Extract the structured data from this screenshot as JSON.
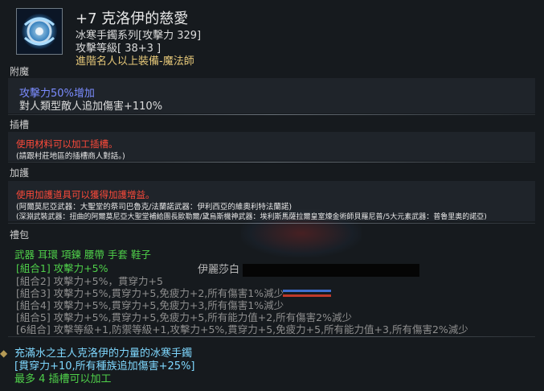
{
  "item": {
    "name": "+7 克洛伊的慈愛",
    "series": "冰寒手鐲系列[攻擊力 329]",
    "level": "攻擊等級[ 38+3 ]",
    "requirement": "進階名人以上裝備-魔法師",
    "icon": "bracelet-icon"
  },
  "sections": {
    "enchant": {
      "label": "附魔",
      "line1": "攻擊力50%增加",
      "line2": "對人類型敵人追加傷害+110%"
    },
    "socket": {
      "label": "插槽",
      "line1": "使用材料可以加工插槽。",
      "line2": "(請跟村莊地區的插槽商人對話。)"
    },
    "protect": {
      "label": "加護",
      "line1": "使用加護道具可以獲得加護增益。",
      "line2": "(阿爾莫尼亞武器：大聖堂的祭司巴魯克/法蘭諾武器：伊利西亞的維奧利特法蘭諾)",
      "line3": "(深淵武裝武器：扭曲的阿爾莫尼亞大聖堂補給團長歐勒爾/黛烏斯機神武器：埃利斯馬薩拉爾皇室煉金術師貝羅尼普/5大元素武器：普魯里奧的諾亞)"
    },
    "setbonus": {
      "label": "禮包",
      "parts": "武器 耳環 項鍊 腰帶 手套 鞋子",
      "rows": [
        "[組合1] 攻擊力+5%",
        "[組合2] 攻擊力+5%，貫穿力+5",
        "[組合3] 攻擊力+5%,貫穿力+5,免疲力+2,所有傷害1%減少",
        "[組合4] 攻擊力+5%,貫穿力+5,免疲力+3,所有傷害1%減少",
        "[組合5] 攻擊力+5%,貫穿力+5,免疲力+5,所有能力值+2,所有傷害2%減少",
        "[6組合] 攻擊等級+1,防禦等級+1,攻擊力+5%,貫穿力+5,免疲力+5,所有能力值+3,所有傷害2%減少"
      ]
    },
    "flavor": {
      "line1": "充滿水之主人克洛伊的力量的冰寒手鐲",
      "line2": "[貫穿力+10,所有種族追加傷害+25%]",
      "line3": "最多 4 插槽可以加工"
    }
  },
  "scene": {
    "nameplate": "伊麗莎白"
  },
  "colors": {
    "red": "#ff4a3a",
    "blue": "#7b8cff",
    "green": "#4fd04a",
    "gold": "#e6c879"
  }
}
